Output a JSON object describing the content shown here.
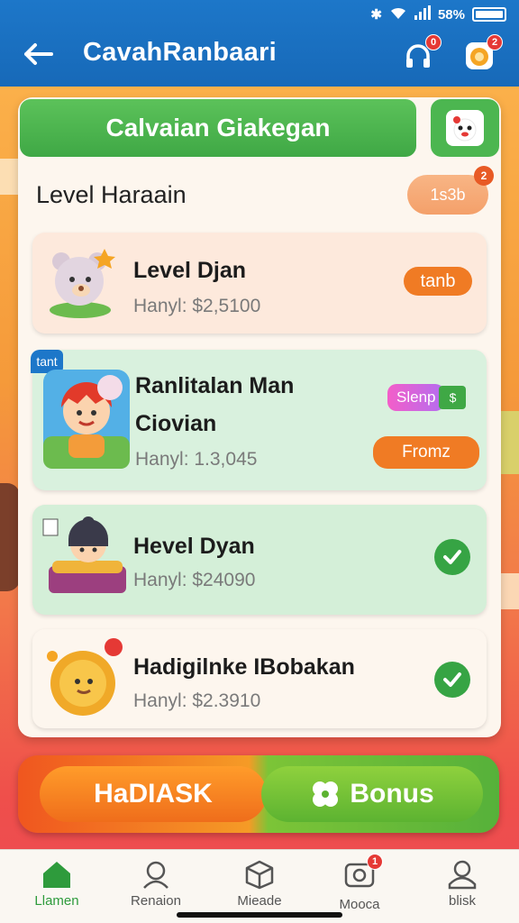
{
  "status": {
    "battery_text": "58%"
  },
  "appbar": {
    "title": "CavahRanbaari",
    "notif_badge": "0",
    "gift_badge": "2"
  },
  "panel": {
    "header": "Calvaian Giakegan",
    "section_title": "Level Haraain",
    "top_pill": "1s3b",
    "top_pill_badge": "2",
    "items": [
      {
        "title": "Level Djan",
        "subtitle": "Hanyl: $2,5100",
        "action": "tanb",
        "bg": "#fde9dc"
      },
      {
        "title_line1": "Ranlitalan Man",
        "title_line2": "Ciovian",
        "subtitle": "Hanyl: 1.3,045",
        "tag": "tant",
        "badge": "Slenp",
        "action": "Fromz",
        "bg": "#d9f1de"
      },
      {
        "title": "Hevel Dyan",
        "subtitle": "Hanyl: $24090",
        "bg": "#d4efd8"
      },
      {
        "title": "Hadigilnke IBobakan",
        "subtitle": "Hanyl: $2.3910",
        "bg": "#fdf6ee"
      }
    ]
  },
  "banner": {
    "left": "HaDIASK",
    "right": "Bonus"
  },
  "tabs": [
    {
      "label": "Llamen",
      "icon": "home-icon",
      "active": true
    },
    {
      "label": "Renaion",
      "icon": "profile-icon"
    },
    {
      "label": "Mieade",
      "icon": "box-icon"
    },
    {
      "label": "Mooca",
      "icon": "camera-icon",
      "badge": "1"
    },
    {
      "label": "blisk",
      "icon": "user-icon"
    }
  ],
  "colors": {
    "primary_blue": "#1d77c9",
    "green": "#3fa845",
    "orange": "#f07b24"
  }
}
